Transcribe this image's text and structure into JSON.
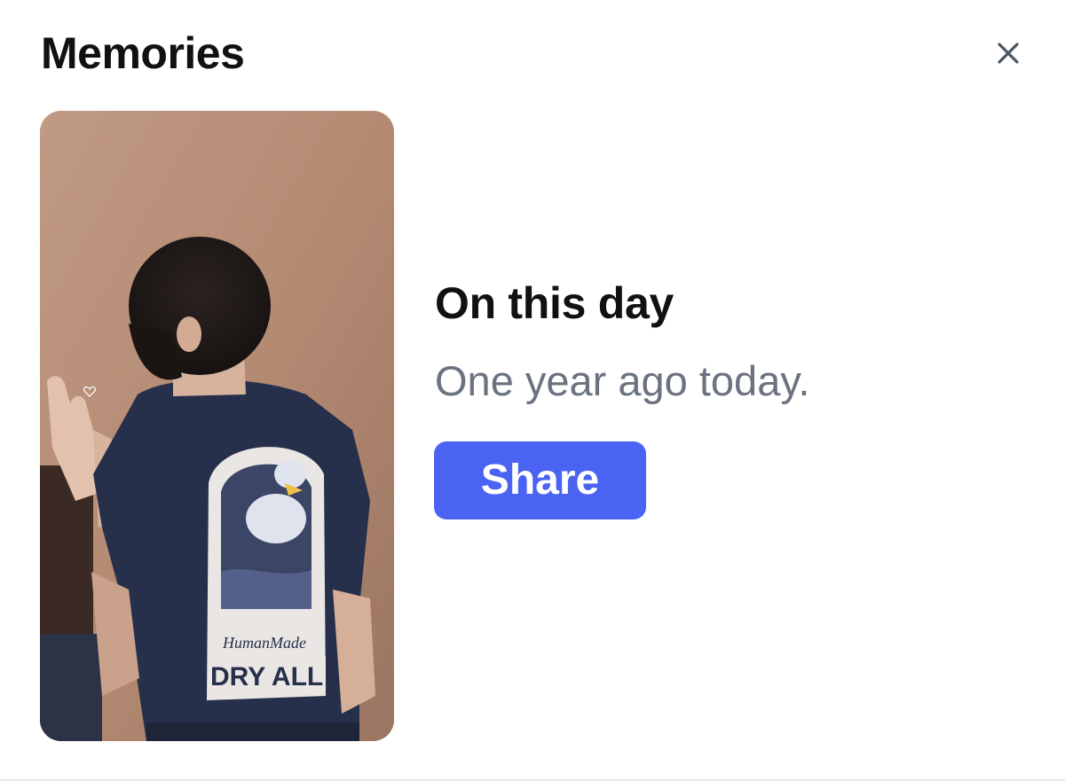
{
  "header": {
    "title": "Memories",
    "close_icon": "close-icon"
  },
  "memory": {
    "heading": "On this day",
    "subtitle": "One year ago today.",
    "share_label": "Share",
    "photo_shirt_text_top": "HumanMade",
    "photo_shirt_text_bottom": "DRY ALL"
  },
  "colors": {
    "accent": "#4b63f2",
    "title_text": "#111111",
    "subtitle_text": "#6b7280",
    "close_icon": "#4b5563",
    "divider": "#e6e7eb"
  }
}
